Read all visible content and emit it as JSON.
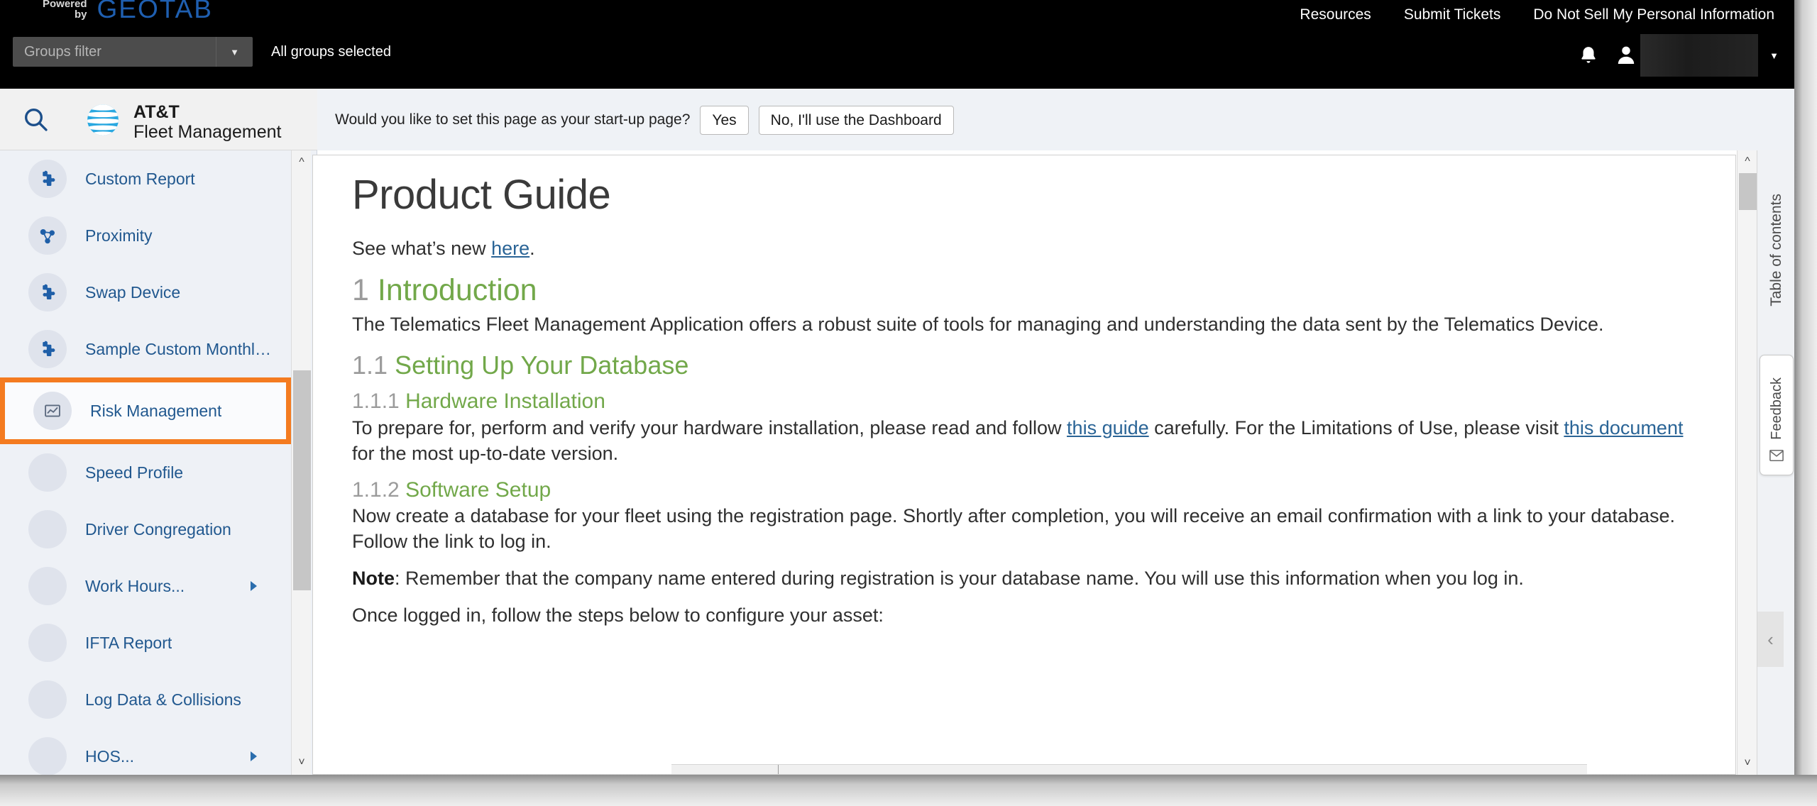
{
  "topbar": {
    "powered_line1": "Powered",
    "powered_line2": "by",
    "brand_logo": "GEOTAB",
    "links": [
      {
        "label": "Resources",
        "icon": "link"
      },
      {
        "label": "Submit Tickets",
        "icon": "link"
      },
      {
        "label": "Do Not Sell My Personal Information",
        "icon": "link"
      }
    ],
    "groups_filter_placeholder": "Groups filter",
    "groups_filter_value": "",
    "groups_selected_text": "All groups selected",
    "bell_icon": "notification-bell-icon",
    "avatar_icon": "user-avatar-icon",
    "user_name": "",
    "caret_icon": "chevron-down-icon"
  },
  "subheader": {
    "search_icon": "search-icon",
    "brand_line1": "AT&T",
    "brand_line2": "Fleet Management",
    "logo_icon": "att-globe-icon"
  },
  "startup_prompt": {
    "question": "Would you like to set this page as your start-up page?",
    "yes_label": "Yes",
    "no_label": "No, I'll use the Dashboard"
  },
  "sidebar": {
    "items": [
      {
        "label": "Custom Report",
        "icon": "puzzle-piece-icon",
        "has_submenu": false,
        "highlighted": false
      },
      {
        "label": "Proximity",
        "icon": "proximity-icon",
        "has_submenu": false,
        "highlighted": false
      },
      {
        "label": "Swap Device",
        "icon": "puzzle-piece-icon",
        "has_submenu": false,
        "highlighted": false
      },
      {
        "label": "Sample Custom Monthly ...",
        "icon": "puzzle-piece-icon",
        "has_submenu": false,
        "highlighted": false
      },
      {
        "label": "Risk Management",
        "icon": "chart-report-icon",
        "has_submenu": false,
        "highlighted": true
      },
      {
        "label": "Speed Profile",
        "icon": "blank-icon",
        "has_submenu": false,
        "highlighted": false
      },
      {
        "label": "Driver Congregation",
        "icon": "blank-icon",
        "has_submenu": false,
        "highlighted": false
      },
      {
        "label": "Work Hours...",
        "icon": "blank-icon",
        "has_submenu": true,
        "highlighted": false
      },
      {
        "label": "IFTA Report",
        "icon": "blank-icon",
        "has_submenu": false,
        "highlighted": false
      },
      {
        "label": "Log Data & Collisions",
        "icon": "blank-icon",
        "has_submenu": false,
        "highlighted": false
      },
      {
        "label": "HOS...",
        "icon": "blank-icon",
        "has_submenu": true,
        "highlighted": false
      }
    ],
    "scroll_up_icon": "chevron-up-icon",
    "scroll_down_icon": "chevron-down-icon"
  },
  "document": {
    "title": "Product Guide",
    "whats_new_prefix": "See what’s new ",
    "whats_new_link": "here",
    "whats_new_suffix": ".",
    "sections": [
      {
        "number": "1",
        "heading": "Introduction",
        "body": "The Telematics Fleet Management Application offers a robust suite of tools for managing and understanding the data sent by the Telematics Device."
      },
      {
        "number": "1.1",
        "heading": "Setting Up Your Database"
      },
      {
        "number": "1.1.1",
        "heading": "Hardware Installation",
        "body_part1": "To prepare for, perform and verify your hardware installation, please read and follow ",
        "link1": "this guide",
        "body_part2": " carefully. For the Limitations of Use, please visit ",
        "link2": "this document",
        "body_part3": " for the most up-to-date version."
      },
      {
        "number": "1.1.2",
        "heading": "Software Setup",
        "body": "Now create a database for your fleet using the registration page. Shortly after completion, you will receive an email confirmation with a link to your database. Follow the link to log in.",
        "note_label": "Note",
        "note_body": ": Remember that the company name entered during registration is your database name. You will use this information when you log in.",
        "closing": "Once logged in, follow the steps below to configure your asset:"
      }
    ]
  },
  "right_rail": {
    "toc_label": "Table of contents",
    "feedback_label": "Feedback",
    "feedback_icon": "envelope-icon",
    "collapse_icon": "chevron-left-icon",
    "scroll_up_icon": "chevron-up-icon",
    "scroll_down_icon": "chevron-down-icon"
  },
  "colors": {
    "topbar_bg": "#000000",
    "geotab_blue": "#1f5fb0",
    "sidebar_bg": "#eef1f6",
    "sidebar_accent": "#1e5fa8",
    "nav_text": "#21588f",
    "highlight_orange": "#f47b20",
    "heading_green": "#72a84a",
    "section_number_gray": "#9b9b9b",
    "link_blue": "#2a6496",
    "att_blue": "#2aa8e0"
  }
}
